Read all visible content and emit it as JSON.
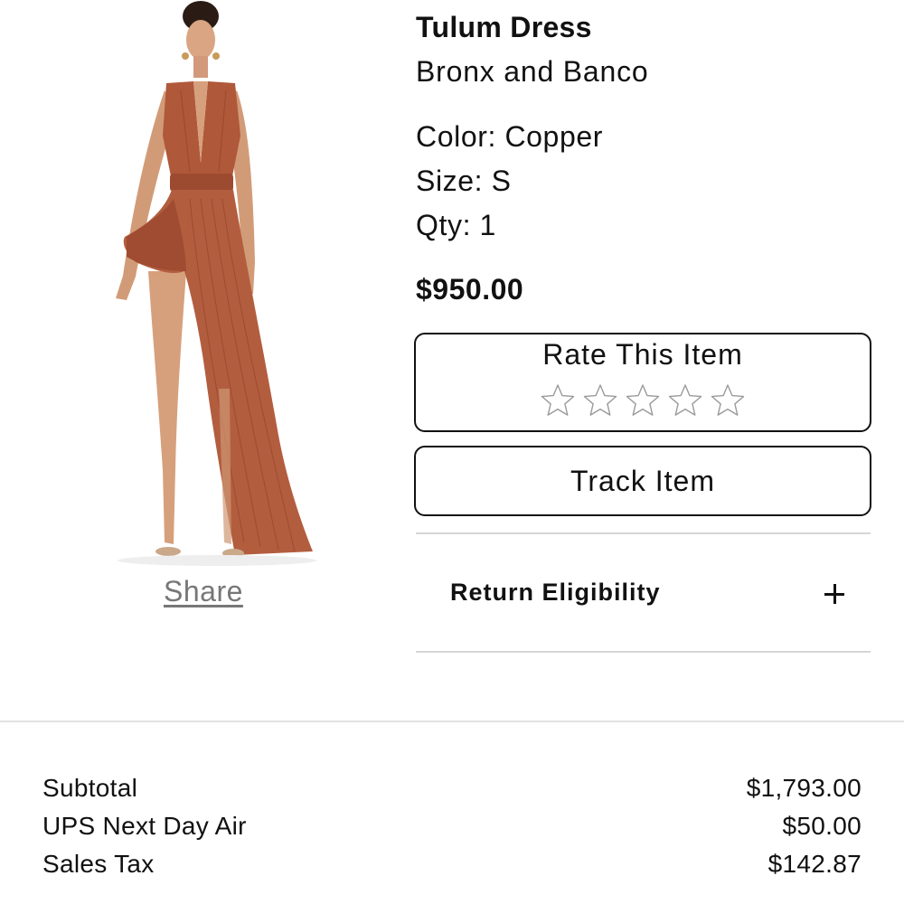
{
  "product": {
    "name": "Tulum Dress",
    "brand": "Bronx and Banco",
    "color": "Color: Copper",
    "size": "Size: S",
    "qty": "Qty: 1",
    "price": "$950.00",
    "image_alt": "Model wearing copper Tulum Dress"
  },
  "share": {
    "label": "Share"
  },
  "rating": {
    "title": "Rate This Item",
    "max_stars": 5,
    "current": 0
  },
  "track": {
    "label": "Track Item"
  },
  "return_eligibility": {
    "label": "Return Eligibility",
    "icon": "plus-icon"
  },
  "summary": {
    "rows": [
      {
        "label": "Subtotal",
        "value": "$1,793.00"
      },
      {
        "label": "UPS Next Day Air",
        "value": "$50.00"
      },
      {
        "label": "Sales Tax",
        "value": "$142.87"
      }
    ]
  },
  "colors": {
    "dress": "#b0583a",
    "skin": "#d9a582",
    "text": "#111111",
    "muted": "#777777",
    "divider": "#d6d6d6"
  }
}
